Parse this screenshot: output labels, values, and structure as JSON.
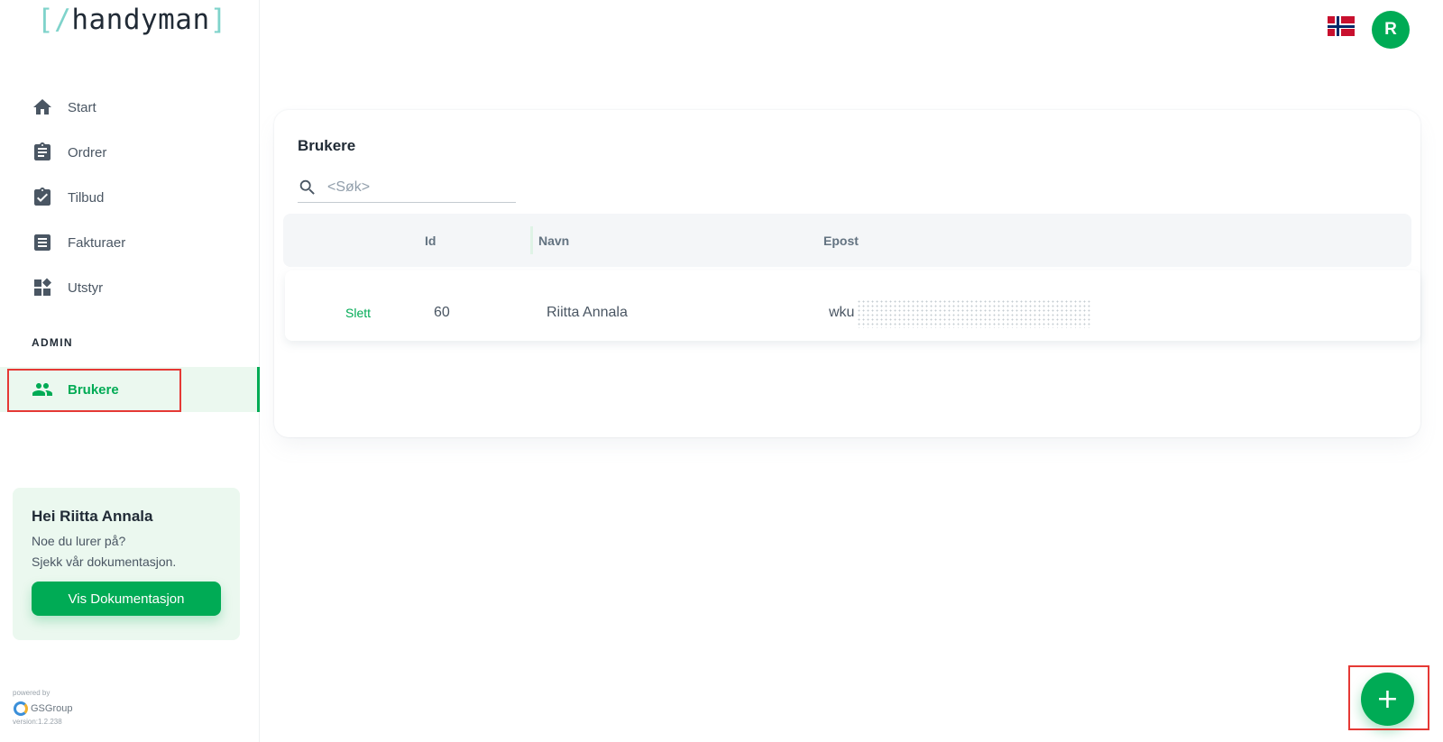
{
  "logo": {
    "open": "[/",
    "name": "handyman",
    "close": "]"
  },
  "sidebar": {
    "items": [
      {
        "label": "Start",
        "icon": "home-icon"
      },
      {
        "label": "Ordrer",
        "icon": "clipboard-icon"
      },
      {
        "label": "Tilbud",
        "icon": "clipboard-check-icon"
      },
      {
        "label": "Fakturaer",
        "icon": "invoice-icon"
      },
      {
        "label": "Utstyr",
        "icon": "dashboard-icon"
      }
    ],
    "section": "ADMIN",
    "active": {
      "label": "Brukere",
      "icon": "people-icon"
    }
  },
  "help": {
    "greeting": "Hei Riitta Annala",
    "line1": "Noe du lurer på?",
    "line2": "Sjekk vår dokumentasjon.",
    "button": "Vis Dokumentasjon"
  },
  "footer": {
    "powered": "powered by",
    "company": "GSGroup",
    "version": "version:1.2.238"
  },
  "header": {
    "avatar_initial": "R",
    "flag": "norway-flag-icon"
  },
  "users": {
    "title": "Brukere",
    "search_placeholder": "<Søk>",
    "columns": {
      "id": "Id",
      "name": "Navn",
      "email": "Epost"
    },
    "rows": [
      {
        "action": "Slett",
        "id": "60",
        "name": "Riitta Annala",
        "email": "wku"
      }
    ]
  },
  "fab": {
    "label": "+"
  },
  "colors": {
    "accent": "#00ab55",
    "accent_light": "#ebf8ef",
    "highlight": "#e53935"
  }
}
